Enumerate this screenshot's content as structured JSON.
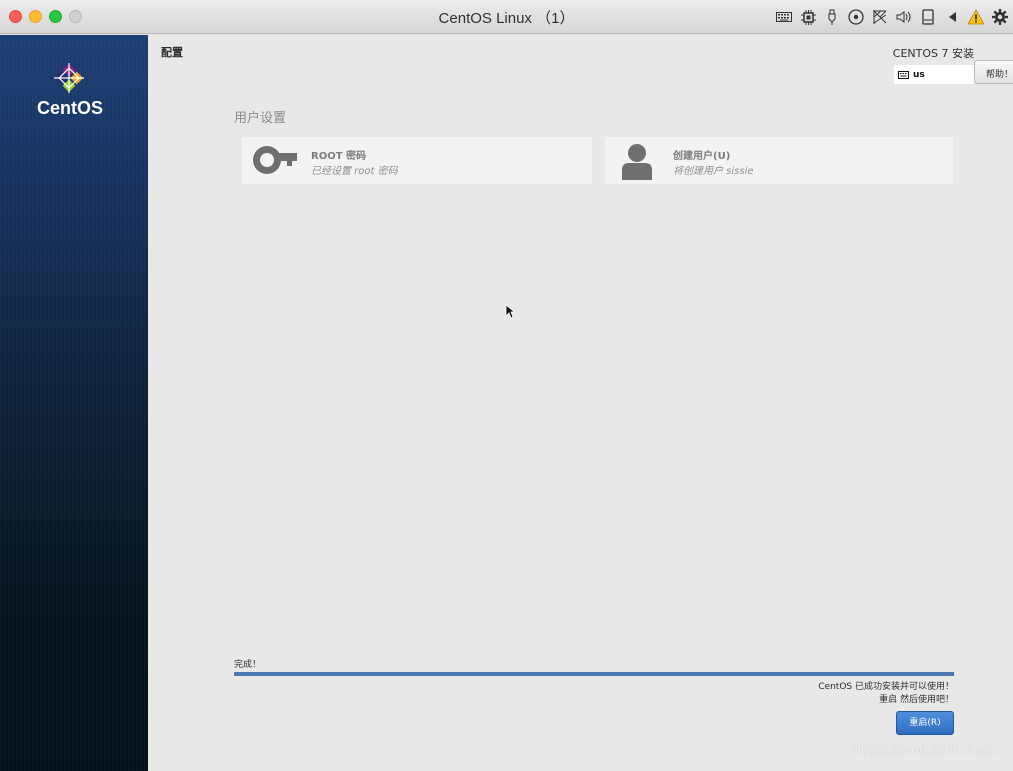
{
  "window": {
    "title": "CentOS Linux （1）"
  },
  "toolbar_icons": [
    "keyboard-icon",
    "cpu-icon",
    "usb-icon",
    "optical-disc-icon",
    "network-icon",
    "speaker-icon",
    "drive-icon",
    "back-arrow-icon",
    "warning-icon",
    "gear-icon"
  ],
  "sidebar": {
    "brand": "CentOS"
  },
  "header": {
    "spoke_title": "配置",
    "product": "CENTOS 7 安装",
    "keyboard_layout": "us",
    "help_button": "帮助！"
  },
  "user_settings": {
    "section_title": "用户设置",
    "spokes": [
      {
        "name": "ROOT 密码",
        "status": "已经设置 root 密码",
        "icon": "key-icon"
      },
      {
        "name": "创建用户(U)",
        "status": "将创建用户 sissie",
        "icon": "user-icon"
      }
    ]
  },
  "progress": {
    "label": "完成！",
    "value_percent": 100,
    "color": "#4a76b3",
    "message_line1": "CentOS 已成功安装并可以使用！",
    "message_line2": "重启 然后使用吧！"
  },
  "reboot_button": "重启(R)",
  "watermark": "https://blog.csdn.net/..."
}
